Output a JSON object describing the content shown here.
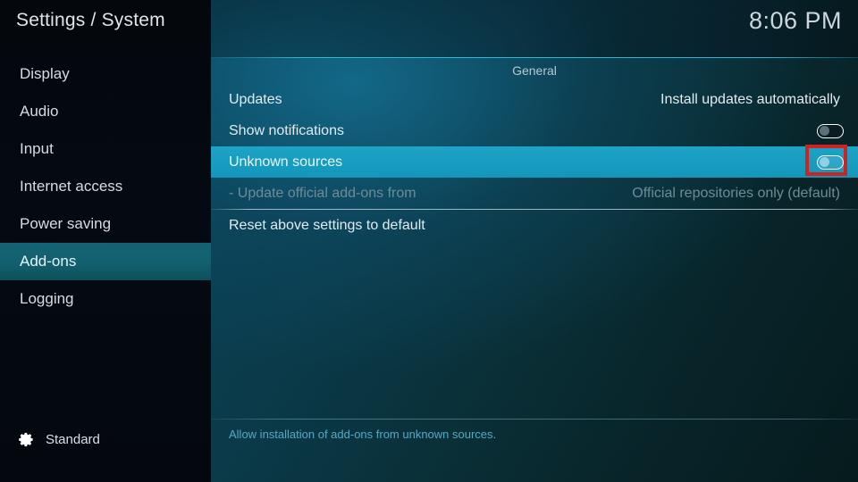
{
  "window": {
    "breadcrumb": "Settings / System",
    "clock": "8:06 PM"
  },
  "sidebar": {
    "items": [
      {
        "label": "Display",
        "selected": false
      },
      {
        "label": "Audio",
        "selected": false
      },
      {
        "label": "Input",
        "selected": false
      },
      {
        "label": "Internet access",
        "selected": false
      },
      {
        "label": "Power saving",
        "selected": false
      },
      {
        "label": "Add-ons",
        "selected": true
      },
      {
        "label": "Logging",
        "selected": false
      }
    ],
    "profile": {
      "icon": "gear-icon",
      "label": "Standard"
    }
  },
  "main": {
    "group_header": "General",
    "rows": [
      {
        "label": "Updates",
        "value": "Install updates automatically",
        "control": "text",
        "selected": false,
        "disabled": false
      },
      {
        "label": "Show notifications",
        "value": "",
        "control": "toggle",
        "toggle_state": "off",
        "selected": false,
        "disabled": false
      },
      {
        "label": "Unknown sources",
        "value": "",
        "control": "toggle",
        "toggle_state": "off",
        "selected": true,
        "disabled": false
      },
      {
        "label": "- Update official add-ons from",
        "value": "Official repositories only (default)",
        "control": "text",
        "selected": false,
        "disabled": true
      },
      {
        "label": "Reset above settings to default",
        "value": "",
        "control": "none",
        "selected": false,
        "disabled": false
      }
    ],
    "help_text": "Allow installation of add-ons from unknown sources."
  },
  "annotation": {
    "color": "#cf2222",
    "target": "unknown-sources-toggle"
  },
  "colors": {
    "sidebar_selected": "#12606f",
    "row_selected": "#189dc1",
    "accent_line": "#34bed7",
    "help_text": "#55a9c4"
  }
}
